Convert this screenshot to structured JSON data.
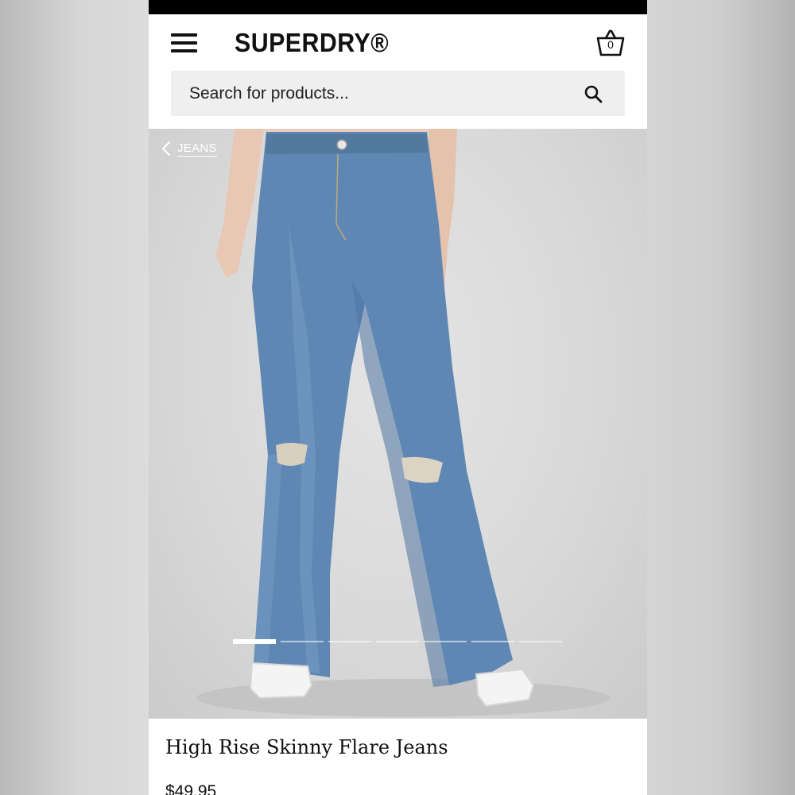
{
  "header": {
    "brand": "SUPERDRY®",
    "basket_count": "0"
  },
  "search": {
    "placeholder": "Search for products..."
  },
  "breadcrumb": {
    "label": "JEANS"
  },
  "gallery": {
    "total_images": 7,
    "active_index": 0
  },
  "product": {
    "title": "High Rise Skinny Flare Jeans",
    "price": "$49.95"
  },
  "icons": {
    "menu": "hamburger-icon",
    "basket": "basket-icon",
    "search": "search-icon",
    "back": "chevron-left-icon"
  },
  "colors": {
    "page_bg": "#ffffff",
    "status_bar": "#000000",
    "search_bg": "#efefef",
    "denim": "#5f87b3",
    "text": "#111111"
  }
}
